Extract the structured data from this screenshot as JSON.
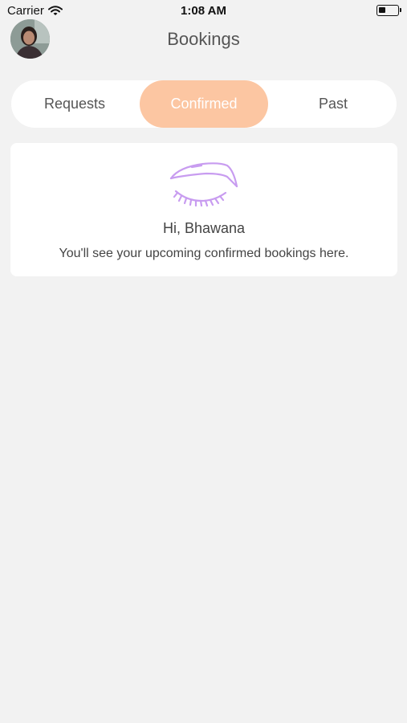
{
  "status_bar": {
    "carrier": "Carrier",
    "time": "1:08 AM",
    "battery_level": 0.35,
    "wifi_icon": "wifi-icon"
  },
  "header": {
    "title": "Bookings",
    "avatar_icon": "user-avatar"
  },
  "tabs": [
    {
      "label": "Requests",
      "active": false
    },
    {
      "label": "Confirmed",
      "active": true
    },
    {
      "label": "Past",
      "active": false
    }
  ],
  "empty_state": {
    "icon": "closed-eye-lash-icon",
    "greeting": "Hi, Bhawana",
    "message": "You'll see your upcoming confirmed bookings here."
  },
  "colors": {
    "accent": "#fcc6a2",
    "icon_purple": "#c89cf0",
    "background": "#f2f2f2"
  }
}
